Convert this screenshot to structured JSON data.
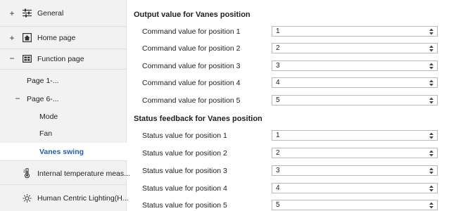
{
  "sidebar": {
    "general": {
      "expander": "+",
      "icon": "sliders-icon",
      "label": "General"
    },
    "home": {
      "expander": "+",
      "icon": "home-icon",
      "label": "Home page"
    },
    "function": {
      "expander": "−",
      "icon": "function-grid-icon",
      "label": "Function page"
    },
    "page1": {
      "label": "Page 1-..."
    },
    "page6": {
      "expander": "−",
      "label": "Page 6-..."
    },
    "mode": {
      "label": "Mode"
    },
    "fan": {
      "label": "Fan"
    },
    "vanes": {
      "label": "Vanes swing"
    },
    "temp": {
      "icon": "thermometer-icon",
      "label": "Internal temperature meas..."
    },
    "hcl": {
      "icon": "sun-icon",
      "label": "Human Centric Lighting(H..."
    }
  },
  "output_section": {
    "title": "Output value for Vanes position",
    "rows": [
      {
        "label": "Command value for position 1",
        "value": "1"
      },
      {
        "label": "Command value for position 2",
        "value": "2"
      },
      {
        "label": "Command value for position 3",
        "value": "3"
      },
      {
        "label": "Command value for position 4",
        "value": "4"
      },
      {
        "label": "Command value for position 5",
        "value": "5"
      }
    ]
  },
  "status_section": {
    "title": "Status feedback for Vanes position",
    "rows": [
      {
        "label": "Status value for position 1",
        "value": "1"
      },
      {
        "label": "Status value for position 2",
        "value": "2"
      },
      {
        "label": "Status value for position 3",
        "value": "3"
      },
      {
        "label": "Status value for position 4",
        "value": "4"
      },
      {
        "label": "Status value for position 5",
        "value": "5"
      }
    ]
  }
}
